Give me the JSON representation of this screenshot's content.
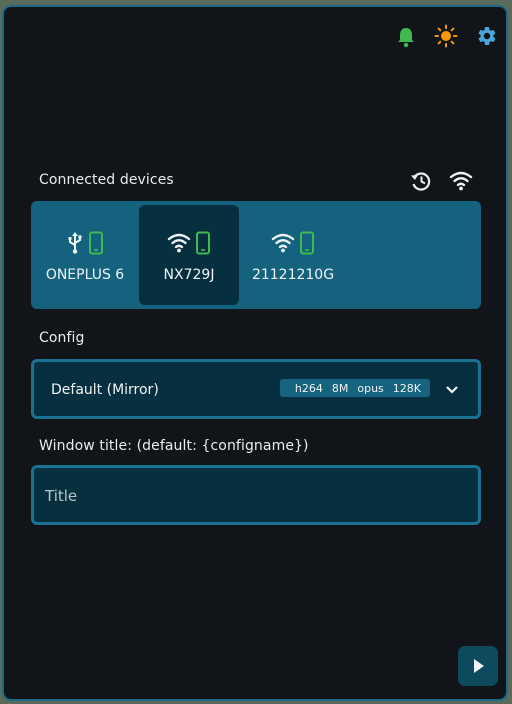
{
  "header_icons": [
    "bell-icon",
    "sun-icon",
    "gear-icon"
  ],
  "colors": {
    "accent": "#14627e",
    "border": "#1a7292",
    "field_bg": "#06303f",
    "status_green": "#3fb950",
    "sun_orange": "#f59a0c",
    "gear_blue": "#4aa8d8"
  },
  "devices_section": {
    "label": "Connected devices",
    "devices": [
      {
        "name": "ONEPLUS 6",
        "connection": "usb-icon",
        "selected": false
      },
      {
        "name": "NX729J",
        "connection": "wifi-icon",
        "selected": true
      },
      {
        "name": "21121210G",
        "connection": "wifi-icon",
        "selected": false
      }
    ]
  },
  "config": {
    "label": "Config",
    "selected": "Default (Mirror)",
    "chip": {
      "video_codec": "h264",
      "video_bitrate": "8M",
      "audio_codec": "opus",
      "audio_bitrate": "128K"
    }
  },
  "window_title": {
    "label": "Window title: (default: {configname})",
    "placeholder": "Title",
    "value": ""
  }
}
